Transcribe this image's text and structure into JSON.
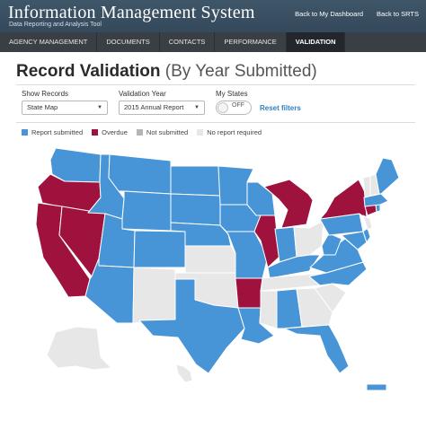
{
  "header": {
    "title": "Information Management System",
    "subtitle": "Data Reporting and Analysis Tool",
    "links": [
      "Back to My Dashboard",
      "Back to SRTS"
    ]
  },
  "nav": {
    "items": [
      "AGENCY MANAGEMENT",
      "DOCUMENTS",
      "CONTACTS",
      "PERFORMANCE",
      "VALIDATION"
    ],
    "active": "VALIDATION"
  },
  "page": {
    "title_bold": "Record Validation",
    "title_light": "(By Year Submitted)"
  },
  "filters": {
    "show_records_label": "Show Records",
    "show_records_value": "State Map",
    "validation_year_label": "Validation Year",
    "validation_year_value": "2015 Annual Report",
    "my_states_label": "My States",
    "my_states_toggle": "OFF",
    "reset_label": "Reset filters"
  },
  "legend": [
    {
      "label": "Report submitted",
      "color": "#4795d6"
    },
    {
      "label": "Overdue",
      "color": "#a0123e"
    },
    {
      "label": "Not submitted",
      "color": "#b5b5b5"
    },
    {
      "label": "No report required",
      "color": "#e7e7e7"
    }
  ],
  "colors": {
    "submitted": "#4795d6",
    "overdue": "#a0123e",
    "not_submitted": "#b5b5b5",
    "not_required": "#e7e7e7"
  },
  "states": [
    {
      "id": "WA",
      "status": "submitted"
    },
    {
      "id": "OR",
      "status": "overdue"
    },
    {
      "id": "CA",
      "status": "overdue"
    },
    {
      "id": "NV",
      "status": "overdue"
    },
    {
      "id": "ID",
      "status": "submitted"
    },
    {
      "id": "MT",
      "status": "submitted"
    },
    {
      "id": "WY",
      "status": "submitted"
    },
    {
      "id": "UT",
      "status": "submitted"
    },
    {
      "id": "AZ",
      "status": "submitted"
    },
    {
      "id": "CO",
      "status": "submitted"
    },
    {
      "id": "NM",
      "status": "not_required"
    },
    {
      "id": "ND",
      "status": "submitted"
    },
    {
      "id": "SD",
      "status": "submitted"
    },
    {
      "id": "NE",
      "status": "submitted"
    },
    {
      "id": "KS",
      "status": "not_required"
    },
    {
      "id": "OK",
      "status": "not_required"
    },
    {
      "id": "TX",
      "status": "submitted"
    },
    {
      "id": "MN",
      "status": "submitted"
    },
    {
      "id": "IA",
      "status": "submitted"
    },
    {
      "id": "MO",
      "status": "submitted"
    },
    {
      "id": "AR",
      "status": "overdue"
    },
    {
      "id": "LA",
      "status": "submitted"
    },
    {
      "id": "WI",
      "status": "submitted"
    },
    {
      "id": "IL",
      "status": "overdue"
    },
    {
      "id": "MI",
      "status": "overdue"
    },
    {
      "id": "IN",
      "status": "submitted"
    },
    {
      "id": "OH",
      "status": "not_required"
    },
    {
      "id": "KY",
      "status": "submitted"
    },
    {
      "id": "TN",
      "status": "not_required"
    },
    {
      "id": "MS",
      "status": "not_required"
    },
    {
      "id": "AL",
      "status": "submitted"
    },
    {
      "id": "GA",
      "status": "not_required"
    },
    {
      "id": "FL",
      "status": "submitted"
    },
    {
      "id": "SC",
      "status": "not_required"
    },
    {
      "id": "NC",
      "status": "submitted"
    },
    {
      "id": "VA",
      "status": "submitted"
    },
    {
      "id": "WV",
      "status": "submitted"
    },
    {
      "id": "PA",
      "status": "submitted"
    },
    {
      "id": "NY",
      "status": "overdue"
    },
    {
      "id": "MD",
      "status": "submitted"
    },
    {
      "id": "DE",
      "status": "submitted"
    },
    {
      "id": "NJ",
      "status": "not_required"
    },
    {
      "id": "CT",
      "status": "overdue"
    },
    {
      "id": "RI",
      "status": "submitted"
    },
    {
      "id": "MA",
      "status": "submitted"
    },
    {
      "id": "VT",
      "status": "not_required"
    },
    {
      "id": "NH",
      "status": "not_required"
    },
    {
      "id": "ME",
      "status": "submitted"
    },
    {
      "id": "AK",
      "status": "not_required"
    },
    {
      "id": "HI",
      "status": "not_required"
    },
    {
      "id": "PR",
      "status": "submitted"
    }
  ]
}
